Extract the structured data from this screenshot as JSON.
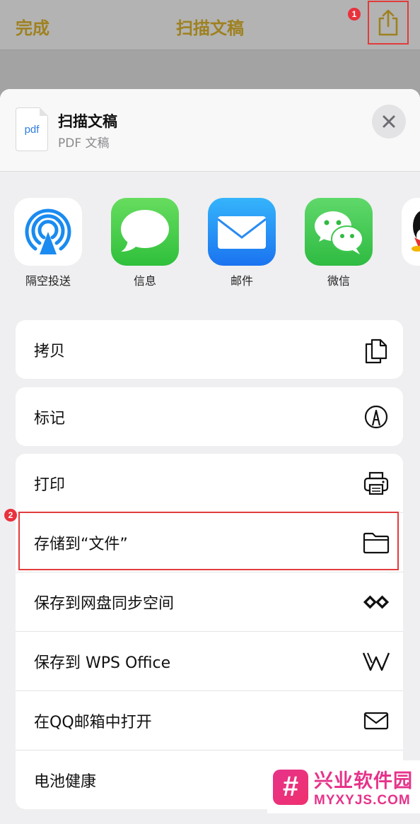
{
  "topbar": {
    "done_label": "完成",
    "title": "扫描文稿",
    "share_badge": "1"
  },
  "sheet": {
    "doc": {
      "thumb_label": "pdf",
      "title": "扫描文稿",
      "subtitle": "PDF 文稿"
    },
    "apps": [
      {
        "label": "隔空投送",
        "icon": "airdrop-icon"
      },
      {
        "label": "信息",
        "icon": "messages-icon"
      },
      {
        "label": "邮件",
        "icon": "mail-icon"
      },
      {
        "label": "微信",
        "icon": "wechat-icon"
      },
      {
        "label": "",
        "icon": "qq-icon"
      }
    ],
    "group1": [
      {
        "label": "拷贝",
        "icon": "copy-icon"
      }
    ],
    "group2": [
      {
        "label": "标记",
        "icon": "markup-icon"
      }
    ],
    "group3": [
      {
        "label": "打印",
        "icon": "printer-icon"
      },
      {
        "label": "存储到“文件”",
        "icon": "folder-icon"
      },
      {
        "label": "保存到网盘同步空间",
        "icon": "sync-space-icon"
      },
      {
        "label": "保存到 WPS Office",
        "icon": "wps-icon"
      },
      {
        "label": "在QQ邮箱中打开",
        "icon": "envelope-icon"
      },
      {
        "label": "电池健康",
        "icon": ""
      }
    ],
    "highlight_badge": "2"
  },
  "watermark": {
    "logo_char": "#",
    "name": "兴业软件园",
    "domain": "MYXYJS.COM"
  },
  "colors": {
    "accent_dimmed": "#9e8120",
    "highlight": "#e23b3b",
    "badge": "#e8323d"
  }
}
